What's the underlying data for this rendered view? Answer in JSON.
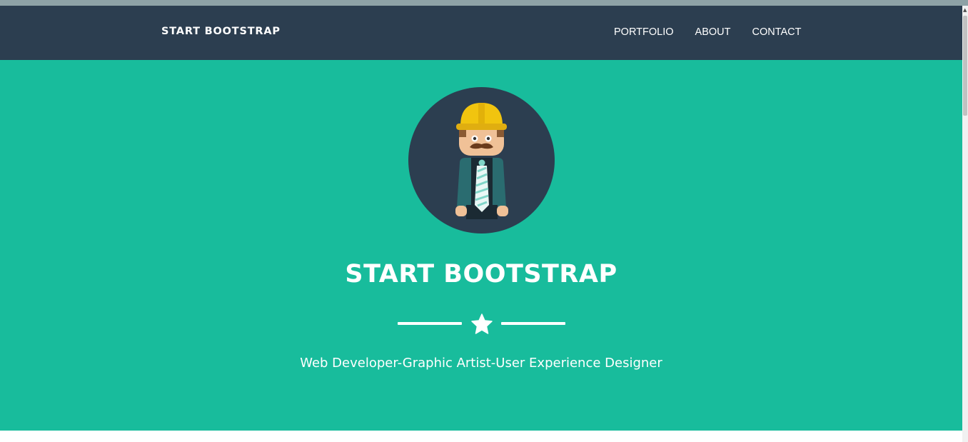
{
  "navbar": {
    "brand": "START BOOTSTRAP",
    "links": [
      {
        "label": "PORTFOLIO"
      },
      {
        "label": "ABOUT"
      },
      {
        "label": "CONTACT"
      }
    ]
  },
  "hero": {
    "avatar_icon": "construction-worker-avatar",
    "title": "START BOOTSTRAP",
    "divider_icon": "star-icon",
    "subtitle": "Web Developer-Graphic Artist-User Experience Designer"
  },
  "colors": {
    "navbar_bg": "#2c3e50",
    "hero_bg": "#18bc9c",
    "text": "#ffffff",
    "helmet": "#f1c40f"
  }
}
